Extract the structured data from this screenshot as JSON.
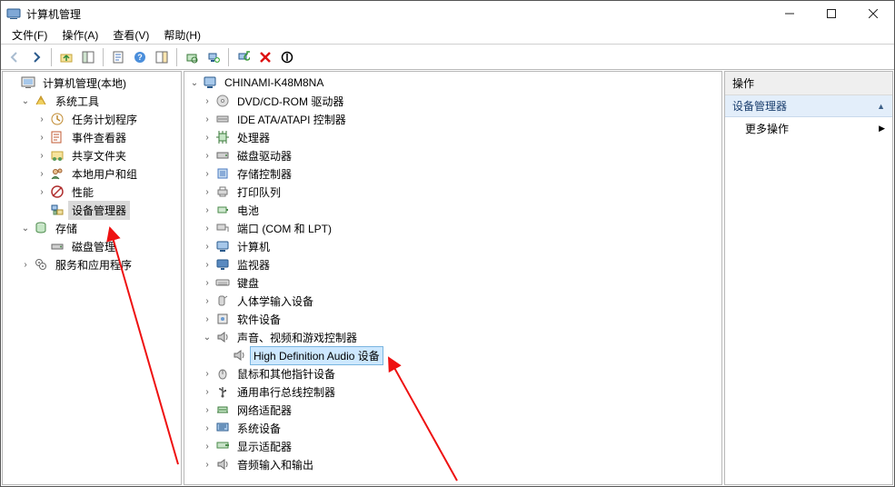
{
  "title": "计算机管理",
  "menu": {
    "file": "文件(F)",
    "action": "操作(A)",
    "view": "查看(V)",
    "help": "帮助(H)"
  },
  "left_tree": {
    "root": "计算机管理(本地)",
    "system_tools": {
      "label": "系统工具",
      "children": [
        {
          "key": "task_scheduler",
          "label": "任务计划程序",
          "expandable": true
        },
        {
          "key": "event_viewer",
          "label": "事件查看器",
          "expandable": true
        },
        {
          "key": "shared_folders",
          "label": "共享文件夹",
          "expandable": true
        },
        {
          "key": "local_users_groups",
          "label": "本地用户和组",
          "expandable": true
        },
        {
          "key": "performance",
          "label": "性能",
          "expandable": true
        },
        {
          "key": "device_manager",
          "label": "设备管理器",
          "expandable": false,
          "selected": true
        }
      ]
    },
    "storage": {
      "label": "存储",
      "children": [
        {
          "key": "disk_management",
          "label": "磁盘管理",
          "expandable": false
        }
      ]
    },
    "services_apps": {
      "label": "服务和应用程序",
      "expandable": true
    }
  },
  "center_tree": {
    "computer_name": "CHINAMI-K48M8NA",
    "categories": [
      {
        "key": "dvd",
        "label": "DVD/CD-ROM 驱动器"
      },
      {
        "key": "ide",
        "label": "IDE ATA/ATAPI 控制器"
      },
      {
        "key": "cpu",
        "label": "处理器"
      },
      {
        "key": "disk_drives",
        "label": "磁盘驱动器"
      },
      {
        "key": "storage_ctrl",
        "label": "存储控制器"
      },
      {
        "key": "print_queues",
        "label": "打印队列"
      },
      {
        "key": "batteries",
        "label": "电池"
      },
      {
        "key": "ports",
        "label": "端口 (COM 和 LPT)"
      },
      {
        "key": "computers",
        "label": "计算机"
      },
      {
        "key": "monitors",
        "label": "监视器"
      },
      {
        "key": "keyboards",
        "label": "键盘"
      },
      {
        "key": "hid",
        "label": "人体学输入设备"
      },
      {
        "key": "software_devices",
        "label": "软件设备"
      },
      {
        "key": "sound",
        "label": "声音、视频和游戏控制器",
        "expanded": true,
        "children": [
          {
            "key": "hda",
            "label": "High Definition Audio 设备",
            "selected": true
          }
        ]
      },
      {
        "key": "mice",
        "label": "鼠标和其他指针设备"
      },
      {
        "key": "usb_controllers",
        "label": "通用串行总线控制器"
      },
      {
        "key": "network",
        "label": "网络适配器"
      },
      {
        "key": "system_devices",
        "label": "系统设备"
      },
      {
        "key": "display_adapters",
        "label": "显示适配器"
      },
      {
        "key": "audio_io",
        "label": "音频输入和输出"
      }
    ]
  },
  "right_pane": {
    "header": "操作",
    "section": "设备管理器",
    "item_more": "更多操作"
  },
  "colors": {
    "selection_blue_bg": "#cde8ff",
    "selection_blue_border": "#7ab5e0",
    "arrow_red": "#e11"
  }
}
